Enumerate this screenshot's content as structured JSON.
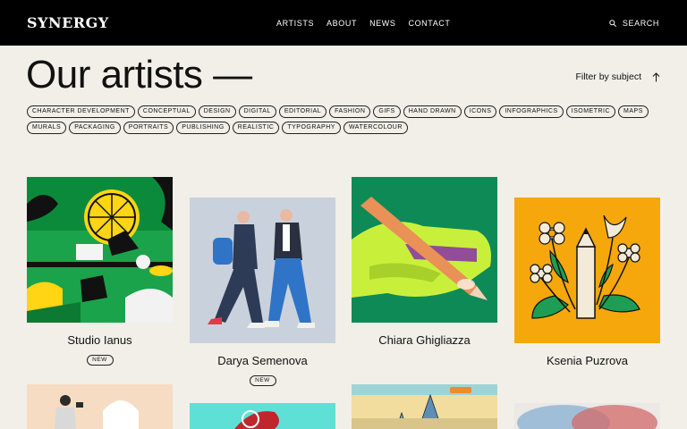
{
  "header": {
    "logo": "SYNERGY",
    "nav": [
      "ARTISTS",
      "ABOUT",
      "NEWS",
      "CONTACT"
    ],
    "search_label": "SEARCH"
  },
  "page": {
    "title": "Our artists —",
    "filter_label": "Filter by subject"
  },
  "tags": [
    "CHARACTER DEVELOPMENT",
    "CONCEPTUAL",
    "DESIGN",
    "DIGITAL",
    "EDITORIAL",
    "FASHION",
    "GIFS",
    "HAND DRAWN",
    "ICONS",
    "INFOGRAPHICS",
    "ISOMETRIC",
    "MAPS",
    "MURALS",
    "PACKAGING",
    "PORTRAITS",
    "PUBLISHING",
    "REALISTIC",
    "TYPOGRAPHY",
    "WATERCOLOUR"
  ],
  "artists": [
    {
      "name": "Studio Ianus",
      "badge": "NEW"
    },
    {
      "name": "Darya Semenova",
      "badge": "NEW"
    },
    {
      "name": "Chiara Ghigliazza"
    },
    {
      "name": "Ksenia Puzrova"
    }
  ],
  "colors": {
    "header_bg": "#000000",
    "page_bg": "#f1efe8",
    "studio_green": "#1aa34a",
    "darya_bg": "#c9d2dc",
    "chiara_bg": "#0e8a57",
    "chiara_hand": "#c8f03b",
    "ksenia_bg": "#f5a70b"
  }
}
